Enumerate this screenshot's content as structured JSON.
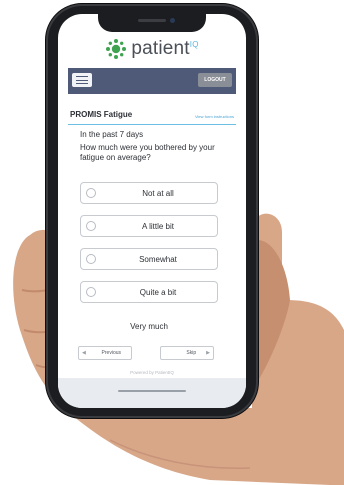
{
  "brand": {
    "name": "patient",
    "superscript": "IQ",
    "accent_color": "#58b7e0",
    "logo_color": "#3fa352"
  },
  "header": {
    "menu_icon": "hamburger-menu-icon",
    "logout_label": "LOGOUT",
    "bar_color": "#4f5a78"
  },
  "survey": {
    "title": "PROMIS Fatigue",
    "instructions_link": "View form instructions",
    "period": "In the past 7 days",
    "question": "How much were you bothered by your fatigue on average?",
    "options": [
      {
        "label": "Not at all",
        "selected": false
      },
      {
        "label": "A little bit",
        "selected": false
      },
      {
        "label": "Somewhat",
        "selected": false
      },
      {
        "label": "Quite a bit",
        "selected": false
      },
      {
        "label": "Very much",
        "selected": false
      }
    ]
  },
  "navigation": {
    "previous_label": "Previous",
    "skip_label": "Skip"
  },
  "footer": {
    "powered_by": "Powered by PatientIQ"
  }
}
